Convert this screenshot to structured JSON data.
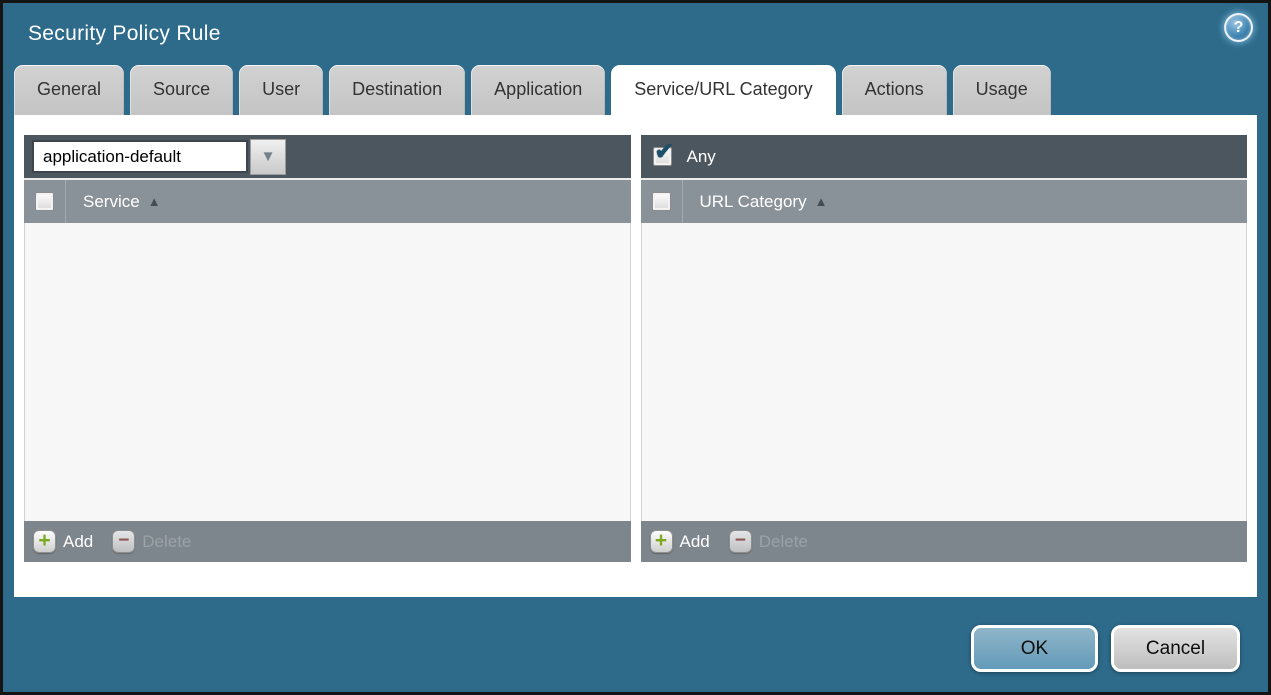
{
  "dialog": {
    "title": "Security Policy Rule"
  },
  "tabs": [
    {
      "label": "General"
    },
    {
      "label": "Source"
    },
    {
      "label": "User"
    },
    {
      "label": "Destination"
    },
    {
      "label": "Application"
    },
    {
      "label": "Service/URL Category"
    },
    {
      "label": "Actions"
    },
    {
      "label": "Usage"
    }
  ],
  "active_tab": "Service/URL Category",
  "service_panel": {
    "dropdown_value": "application-default",
    "column_header": "Service",
    "rows": [],
    "add_label": "Add",
    "delete_label": "Delete",
    "delete_enabled": false
  },
  "url_category_panel": {
    "any_label": "Any",
    "any_checked": true,
    "column_header": "URL Category",
    "rows": [],
    "add_label": "Add",
    "delete_label": "Delete",
    "delete_enabled": false
  },
  "buttons": {
    "ok": "OK",
    "cancel": "Cancel"
  },
  "icons": {
    "help": "?",
    "add": "+",
    "delete": "−",
    "check": "✔",
    "sort_asc": "▲",
    "dropdown_arrow": "▼"
  },
  "colors": {
    "background_teal": "#2E6B8B",
    "toolbar_dark": "#4C565E",
    "header_gray": "#8A9299",
    "footer_gray": "#7D868D",
    "add_green": "#7CA91F",
    "delete_red": "#954840",
    "ok_blue": "#6FA3BE",
    "check_teal": "#1D5068"
  }
}
